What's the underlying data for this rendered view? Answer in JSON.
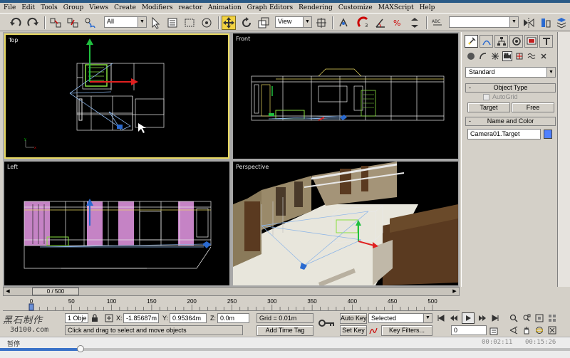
{
  "menu": [
    "File",
    "Edit",
    "Tools",
    "Group",
    "Views",
    "Create",
    "Modifiers",
    "reactor",
    "Animation",
    "Graph Editors",
    "Rendering",
    "Customize",
    "MAXScript",
    "Help"
  ],
  "toolbar": {
    "selection_filter": "All",
    "ref_coord": "View",
    "named_selection": ""
  },
  "viewports": {
    "top": "Top",
    "front": "Front",
    "left": "Left",
    "perspective": "Perspective"
  },
  "command_panel": {
    "category_dropdown": "Standard",
    "object_type_title": "Object Type",
    "autogrid_label": "AutoGrid",
    "target_button": "Target",
    "free_button": "Free",
    "name_color_title": "Name and Color",
    "object_name": "Camera01.Target",
    "object_color": "#4f80ff",
    "rollout_toggle": "-"
  },
  "timeline": {
    "slider_label": "0 / 500",
    "total_frames": 500,
    "current_frame": 0,
    "ticks": [
      "0",
      "50",
      "100",
      "150",
      "200",
      "250",
      "300",
      "350",
      "400",
      "450",
      "500"
    ]
  },
  "status": {
    "logo_line1": "黑石制作",
    "logo_line2": "3d100.com",
    "selection_count": "1 Obje",
    "x_label": "X:",
    "x_value": "-1.85687m",
    "y_label": "Y:",
    "y_value": "0.95364m",
    "z_label": "Z:",
    "z_value": "0.0m",
    "grid": "Grid = 0.01m",
    "prompt": "Click and drag to select and move objects",
    "add_time_tag": "Add Time Tag",
    "auto_key": "Auto Key",
    "set_key": "Set Key",
    "key_mode_select": "Selected",
    "key_filters": "Key Filters...",
    "frame_value": "0"
  },
  "player": {
    "status": "暂停",
    "current_time": "00:02:11",
    "total_time": "00:15:26",
    "progress": 0.1415
  },
  "colors": {
    "active_viewport_border": "#e8d860",
    "viewport_bg": "#000000",
    "ui_face": "#d4d0c8",
    "select_color": "#f2d240"
  }
}
